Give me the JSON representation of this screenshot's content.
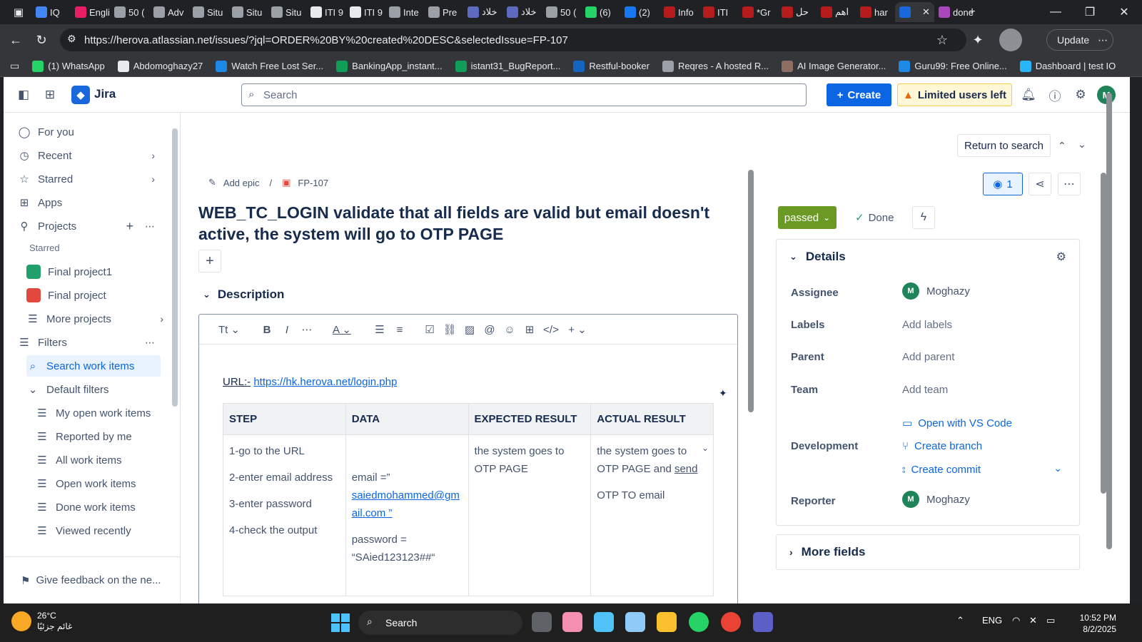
{
  "browser": {
    "tabs": [
      {
        "label": "IQ",
        "color": "#4285f4"
      },
      {
        "label": "Engli",
        "color": "#e91e63"
      },
      {
        "label": "50 (",
        "color": "#9aa0a6"
      },
      {
        "label": "Adv",
        "color": "#9aa0a6"
      },
      {
        "label": "Situ",
        "color": "#9aa0a6"
      },
      {
        "label": "Situ",
        "color": "#9aa0a6"
      },
      {
        "label": "Situ",
        "color": "#9aa0a6"
      },
      {
        "label": "ITI 9",
        "color": "#e8eaed"
      },
      {
        "label": "ITI 9",
        "color": "#e8eaed"
      },
      {
        "label": "Inte",
        "color": "#9aa0a6"
      },
      {
        "label": "Pre",
        "color": "#9aa0a6"
      },
      {
        "label": "خلاد",
        "color": "#5c6bc0"
      },
      {
        "label": "خلاد",
        "color": "#5c6bc0"
      },
      {
        "label": "50 (",
        "color": "#9aa0a6"
      },
      {
        "label": "(6)",
        "color": "#25d366"
      },
      {
        "label": "(2)",
        "color": "#1877f2"
      },
      {
        "label": "Info",
        "color": "#b71c1c"
      },
      {
        "label": "ITI",
        "color": "#b71c1c"
      },
      {
        "label": "*Gr",
        "color": "#b71c1c"
      },
      {
        "label": "حل",
        "color": "#b71c1c"
      },
      {
        "label": "اهم",
        "color": "#b71c1c"
      },
      {
        "label": "har",
        "color": "#b71c1c"
      },
      {
        "label": "",
        "color": "#1868db"
      },
      {
        "label": "done",
        "color": "#ab47bc"
      }
    ],
    "url": "https://herova.atlassian.net/issues/?jql=ORDER%20BY%20created%20DESC&selectedIssue=FP-107",
    "update_label": "Update",
    "bookmarks": [
      {
        "label": "(1) WhatsApp",
        "color": "#25d366"
      },
      {
        "label": "Abdomoghazy27",
        "color": "#e8eaed"
      },
      {
        "label": "Watch Free Lost Ser...",
        "color": "#1e88e5"
      },
      {
        "label": "BankingApp_instant...",
        "color": "#0f9d58"
      },
      {
        "label": "istant31_BugReport...",
        "color": "#0f9d58"
      },
      {
        "label": "Restful-booker",
        "color": "#1565c0"
      },
      {
        "label": "Reqres - A hosted R...",
        "color": "#9aa0a6"
      },
      {
        "label": "AI Image Generator...",
        "color": "#8d6e63"
      },
      {
        "label": "Guru99: Free Online...",
        "color": "#1e88e5"
      },
      {
        "label": "Dashboard | test IO",
        "color": "#29b6f6"
      }
    ]
  },
  "topnav": {
    "app_name": "Jira",
    "search_placeholder": "Search",
    "create_label": "Create",
    "limited_label": "Limited users left",
    "avatar_initial": "M"
  },
  "sidebar": {
    "items": [
      "For you",
      "Recent",
      "Starred",
      "Apps",
      "Projects"
    ],
    "starred_label": "Starred",
    "projects": [
      "Final project1",
      "Final project"
    ],
    "more_projects": "More projects",
    "filters": "Filters",
    "search_work_items": "Search work items",
    "default_filters": "Default filters",
    "filter_items": [
      "My open work items",
      "Reported by me",
      "All work items",
      "Open work items",
      "Done work items",
      "Viewed recently"
    ],
    "feedback": "Give feedback on the ne..."
  },
  "issue": {
    "return_label": "Return to search",
    "breadcrumb_epic": "Add epic",
    "breadcrumb_sep": "/",
    "key": "FP-107",
    "title": "WEB_TC_LOGIN validate that all fields are valid but email doesn't active, the system will go to OTP PAGE",
    "description_label": "Description",
    "url_label": "URL:-",
    "url_value": "https://hk.herova.net/login.php",
    "table": {
      "headers": [
        "STEP",
        "DATA",
        "EXPECTED RESULT",
        "ACTUAL RESULT"
      ],
      "steps": [
        "1-go to the URL",
        "2-enter email address",
        "3-enter password",
        "4-check the output"
      ],
      "data_email_prefix": "email =”",
      "data_email_value": "saiedmohammed@gmail.com ”",
      "data_password_label": "password =",
      "data_password_value": "“SAied123123##“",
      "expected": "the system goes to OTP PAGE",
      "actual_prefix": "the system goes to OTP PAGE and",
      "actual_link": "send",
      "actual_suffix": "OTP TO email"
    }
  },
  "panel": {
    "watch_count": "1",
    "status": "passed",
    "done_label": "Done",
    "details_label": "Details",
    "assignee_label": "Assignee",
    "assignee_value": "Moghazy",
    "labels_label": "Labels",
    "labels_value": "Add labels",
    "parent_label": "Parent",
    "parent_value": "Add parent",
    "team_label": "Team",
    "team_value": "Add team",
    "development_label": "Development",
    "dev_vscode": "Open with VS Code",
    "dev_branch": "Create branch",
    "dev_commit": "Create commit",
    "reporter_label": "Reporter",
    "reporter_value": "Moghazy",
    "more_fields": "More fields"
  },
  "taskbar": {
    "temp": "26°C",
    "weather_text": "غائم جزئيًا",
    "search_label": "Search",
    "lang": "ENG",
    "time": "10:52 PM",
    "date": "8/2/2025"
  }
}
